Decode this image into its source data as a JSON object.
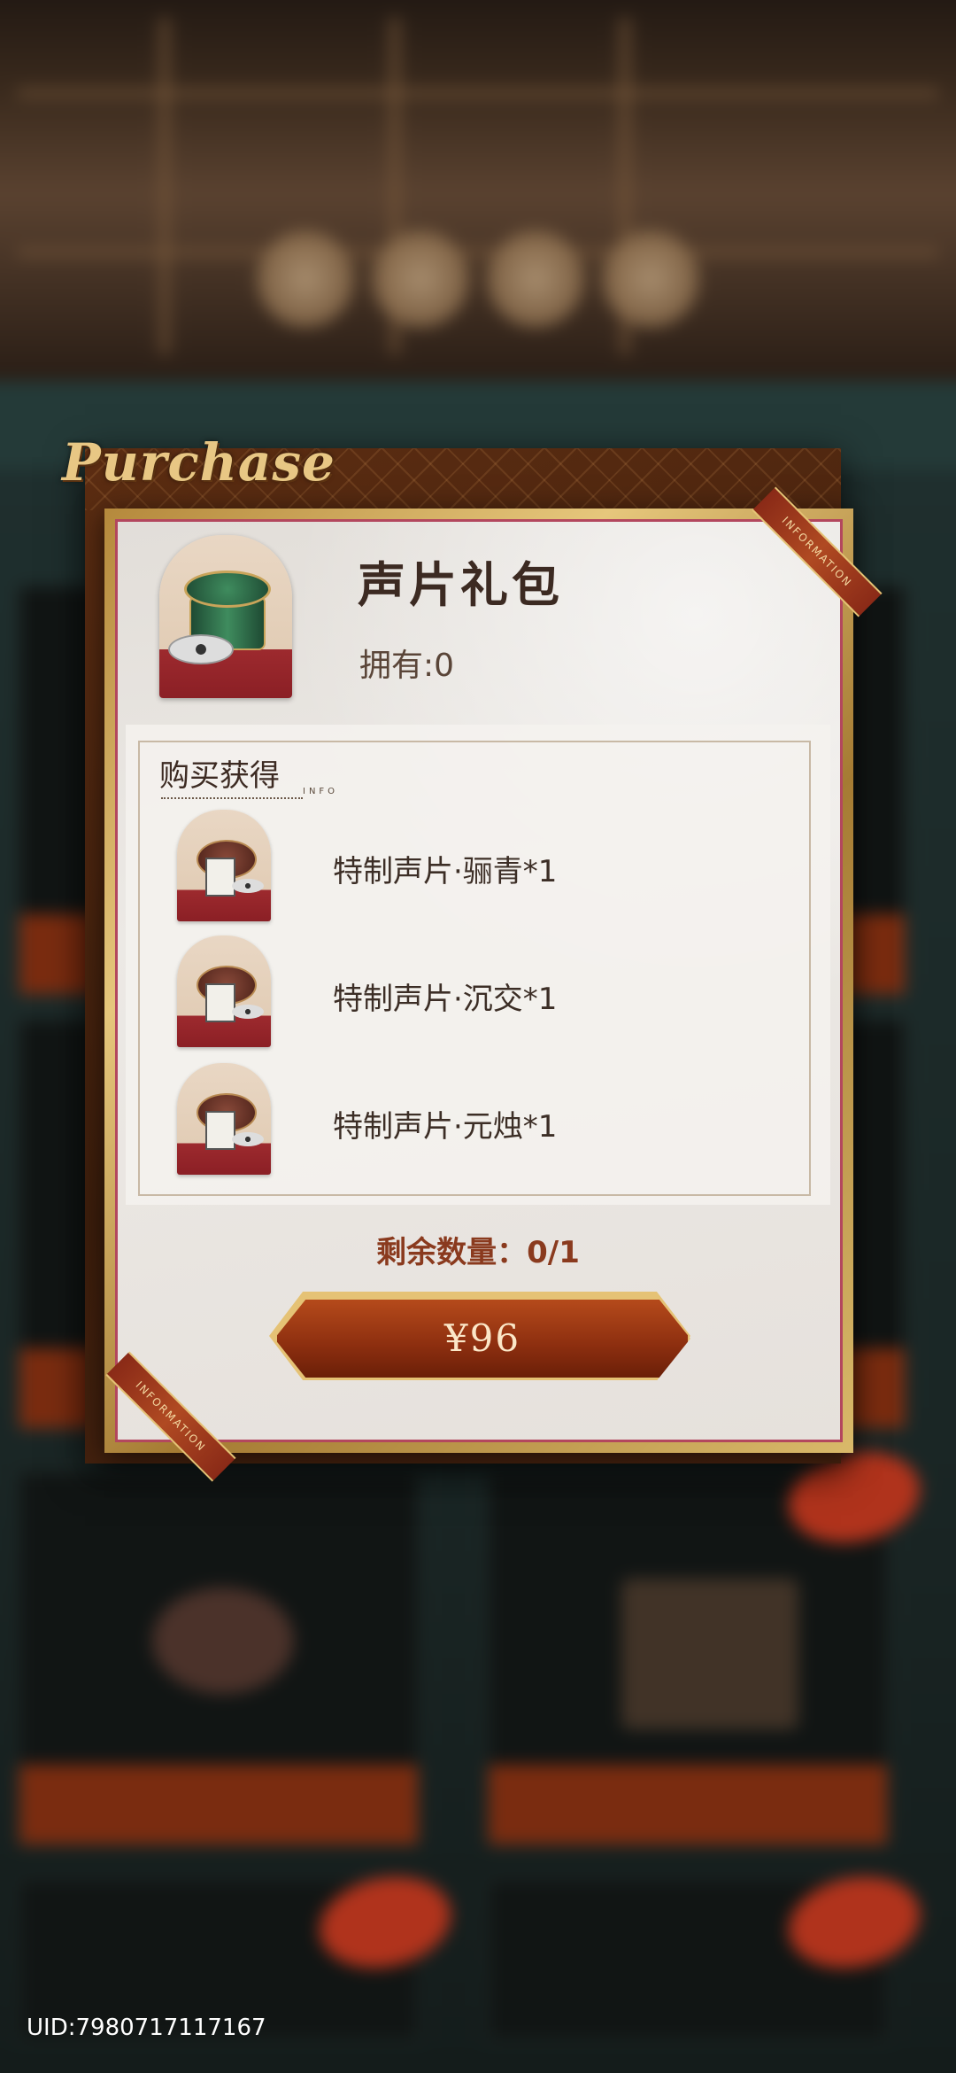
{
  "dialog": {
    "logo_text": "Purchase",
    "ribbon_text": "INFORMATION",
    "product_name": "声片礼包",
    "owned_text": "拥有:0",
    "rewards_label": "购买获得",
    "rewards_sublabel": "INFO",
    "rewards": [
      {
        "label": "特制声片·骊青*1"
      },
      {
        "label": "特制声片·沉交*1"
      },
      {
        "label": "特制声片·元烛*1"
      }
    ],
    "remaining_text": "剩余数量：0/1",
    "price_button": "¥96"
  },
  "footer": {
    "uid": "UID:7980717117167"
  },
  "colors": {
    "accent_gold": "#e5c275",
    "button_red": "#8c2e0f",
    "panel_border": "#b3475e"
  }
}
